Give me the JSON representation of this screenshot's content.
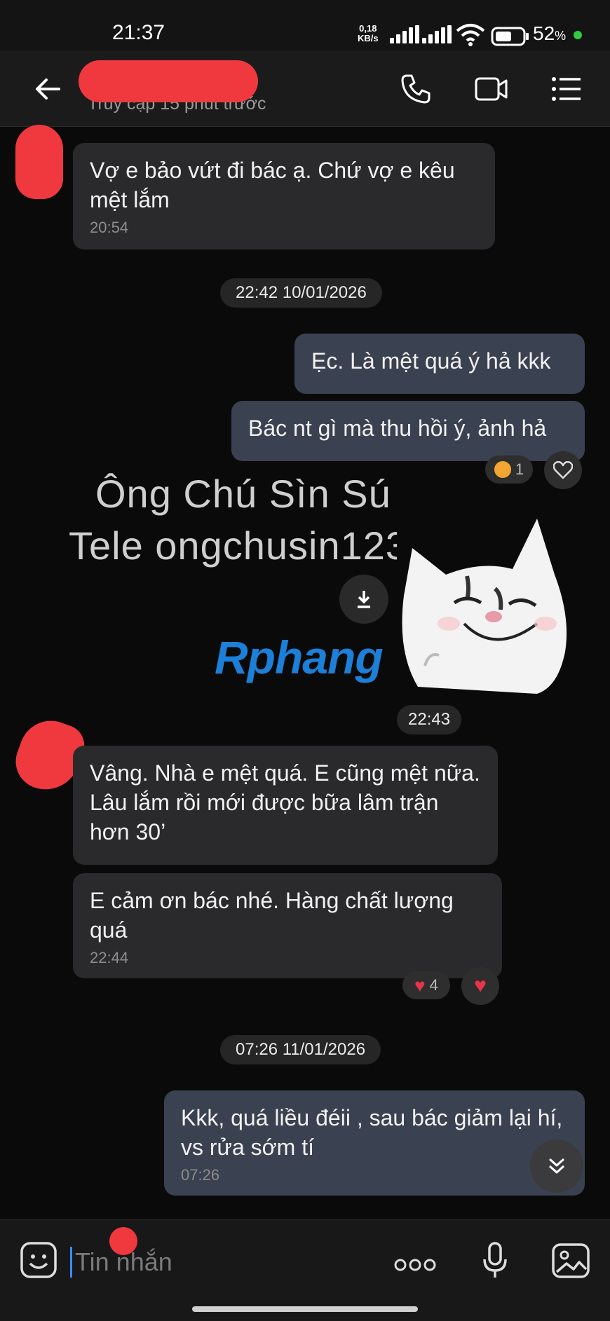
{
  "status_bar": {
    "time": "21:37",
    "net_speed": "0,18",
    "net_unit": "KB/s",
    "battery_percent": "52",
    "battery_unit": "%"
  },
  "header": {
    "last_seen": "Truy cập 15 phút trước",
    "back_icon": "arrow-left",
    "call_icon": "phone",
    "video_icon": "video-camera",
    "menu_icon": "list"
  },
  "messages": [
    {
      "text": "Vợ e bảo vứt đi bác ạ. Chứ vợ e kêu mệt lắm",
      "time": "20:54"
    },
    {
      "date": "22:42 10/01/2026"
    },
    {
      "text": "Ẹc. Là mệt quá ý hả kkk"
    },
    {
      "text": "Bác nt gì mà thu hồi ý, ảnh hả",
      "reaction_count": "1"
    },
    {
      "sticker": "cat-smiling",
      "time": "22:43"
    },
    {
      "text": "Vâng. Nhà e mệt quá. E cũng mệt nữa. Lâu lắm rồi mới được bữa lâm trận hơn 30’"
    },
    {
      "text": "E cảm ơn bác nhé. Hàng chất lượng quá",
      "time": "22:44",
      "reaction_count": "4"
    },
    {
      "date": "07:26 11/01/2026"
    },
    {
      "text": "Kkk, quá liều đéii , sau bác giảm lại hí, vs rửa sớm tí",
      "time": "07:26"
    }
  ],
  "watermark": {
    "line1": "Ông Chú Sìn Sú",
    "line2": "Tele ongchusin123",
    "brand": "Rphang"
  },
  "composer": {
    "placeholder": "Tin nhắn"
  },
  "colors": {
    "bubble_in": "#2a2a2c",
    "bubble_out": "#3a4150",
    "redaction": "#f0393f",
    "heart": "#e8334a"
  }
}
